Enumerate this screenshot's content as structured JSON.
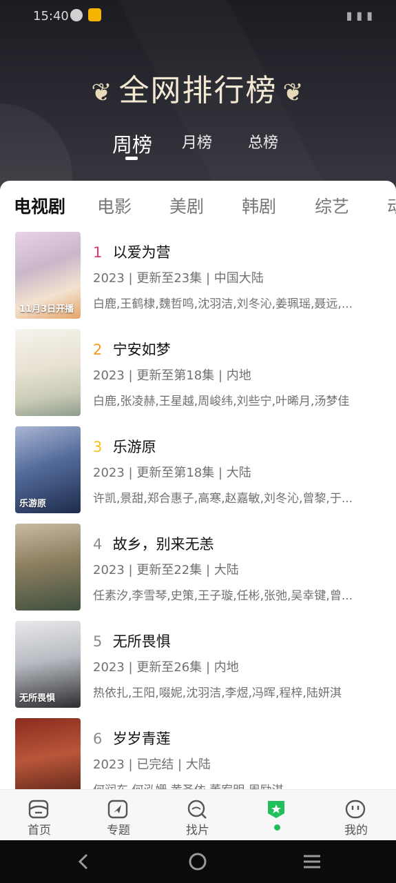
{
  "status_bar": {
    "time": "15:40"
  },
  "header": {
    "title": "全网排行榜",
    "period_tabs": [
      "周榜",
      "月榜",
      "总榜"
    ],
    "active_period": "周榜"
  },
  "category_tabs": [
    "电视剧",
    "电影",
    "美剧",
    "韩剧",
    "综艺",
    "动"
  ],
  "active_category": "电视剧",
  "rank_colors": {
    "1": "#e0386b",
    "2": "#f39a1a",
    "3": "#f1c21b",
    "other": "#8a8a8a"
  },
  "items": [
    {
      "rank": "1",
      "title": "以爱为营",
      "meta": "2023 | 更新至23集 | 中国大陆",
      "cast": "白鹿,王鹤棣,魏哲鸣,沈羽洁,刘冬沁,姜珮瑶,聂远,...",
      "poster_text": "11月3日开播"
    },
    {
      "rank": "2",
      "title": "宁安如梦",
      "meta": "2023 | 更新至第18集 | 内地",
      "cast": "白鹿,张凌赫,王星越,周峻纬,刘些宁,叶晞月,汤梦佳",
      "poster_text": ""
    },
    {
      "rank": "3",
      "title": "乐游原",
      "meta": "2023 | 更新至第18集 | 大陆",
      "cast": "许凯,景甜,郑合惠子,高寒,赵嘉敏,刘冬沁,曾黎,于...",
      "poster_text": "乐游原"
    },
    {
      "rank": "4",
      "title": "故乡，别来无恙",
      "meta": "2023 | 更新至22集 | 大陆",
      "cast": "任素汐,李雪琴,史策,王子璇,任彬,张弛,吴幸键,曾...",
      "poster_text": ""
    },
    {
      "rank": "5",
      "title": "无所畏惧",
      "meta": "2023 | 更新至26集 | 内地",
      "cast": "热依扎,王阳,啜妮,沈羽洁,李煜,冯晖,程梓,陆妍淇",
      "poster_text": "无所畏惧"
    },
    {
      "rank": "6",
      "title": "岁岁青莲",
      "meta": "2023 | 已完结 | 大陆",
      "cast": "何润东,何泓姗,黄圣依,董宥明,周励淇",
      "poster_text": ""
    }
  ],
  "bottom_nav": [
    {
      "label": "首页",
      "icon": "home-icon"
    },
    {
      "label": "专题",
      "icon": "topic-icon"
    },
    {
      "label": "找片",
      "icon": "search-icon"
    },
    {
      "label": "",
      "icon": "ranking-badge-icon",
      "active": true
    },
    {
      "label": "我的",
      "icon": "profile-icon"
    }
  ]
}
